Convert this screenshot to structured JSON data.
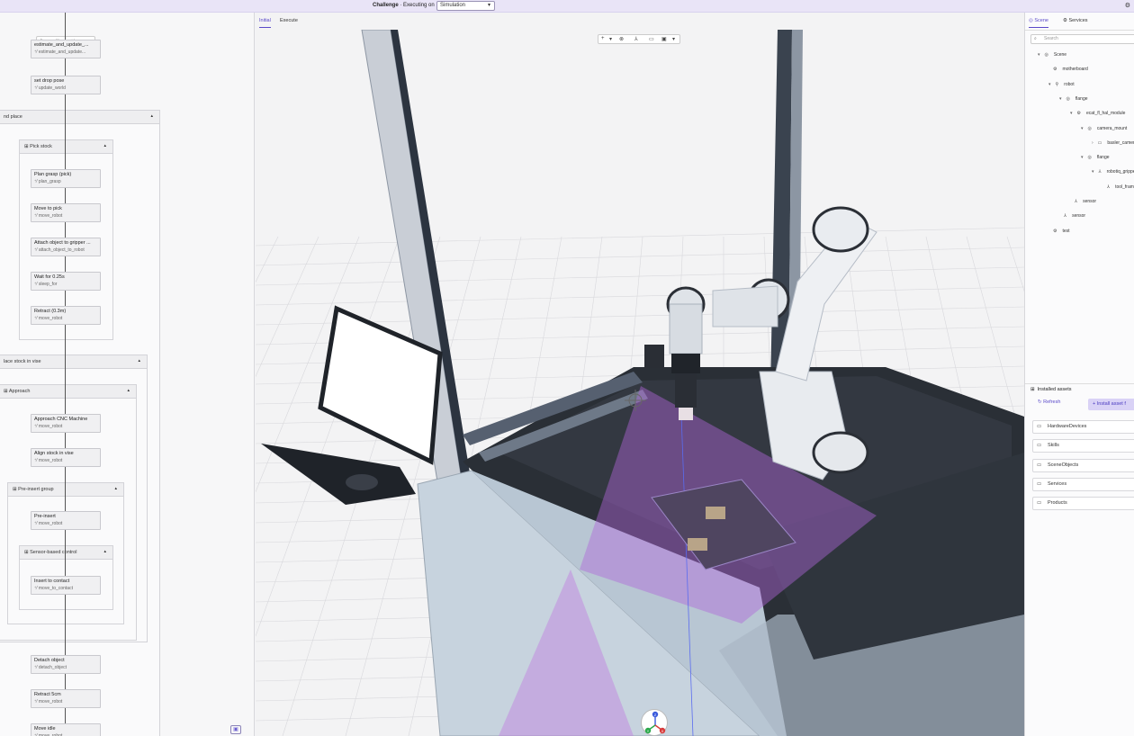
{
  "topbar": {
    "title_bold": "Challenge",
    "title_rest": " · Executing on",
    "executor": "Simulation",
    "settings_icon": "gear-icon"
  },
  "flow": {
    "controls": "▷ □ ⏭ ◎",
    "nodes": [
      {
        "title": "estimate_and_update_...",
        "skill": "estimate_and_update..."
      },
      {
        "title": "set drop pose",
        "skill": "update_world"
      },
      {
        "title": "Plan grasp (pick)",
        "skill": "plan_grasp"
      },
      {
        "title": "Move to pick",
        "skill": "move_robot"
      },
      {
        "title": "Attach object to gripper ...",
        "skill": "attach_object_to_robot"
      },
      {
        "title": "Wait for 0.25s",
        "skill": "sleep_for"
      },
      {
        "title": "Retract (0.3m)",
        "skill": "move_robot"
      },
      {
        "title": "Approach CNC Machine",
        "skill": "move_robot"
      },
      {
        "title": "Align stock in vise",
        "skill": "move_robot"
      },
      {
        "title": "Pre-insert",
        "skill": "move_robot"
      },
      {
        "title": "Insert to contact",
        "skill": "move_to_contact"
      },
      {
        "title": "Detach object",
        "skill": "detach_object"
      },
      {
        "title": "Retract 5cm",
        "skill": "move_robot"
      },
      {
        "title": "Move idle",
        "skill": "move_robot"
      }
    ],
    "groups": {
      "pick_and_place": "nd place",
      "pick_stock": "Pick stock",
      "place_stock": "lace stock in vise",
      "approach": "Approach",
      "pre_insert": "Pre-insert group",
      "sensor_control": "Sensor-based control"
    }
  },
  "viewport": {
    "tabs": [
      "Initial",
      "Execute"
    ],
    "toolbar": [
      "+",
      "▾",
      "⊗",
      "⅄",
      "▭",
      "▣",
      "▾"
    ],
    "gizmo_axes": [
      "Z",
      "Y",
      "X"
    ]
  },
  "right": {
    "tabs": [
      "Scene",
      "Services"
    ],
    "search_placeholder": "Search",
    "tree": [
      {
        "label": "Scene",
        "depth": 0,
        "caret": "▾",
        "icon": "◎"
      },
      {
        "label": "motherboard",
        "depth": 1,
        "caret": "",
        "icon": "⚙"
      },
      {
        "label": "robot",
        "depth": 1,
        "caret": "▾",
        "icon": "⚲"
      },
      {
        "label": "flange",
        "depth": 2,
        "caret": "▾",
        "icon": "◎"
      },
      {
        "label": "ecat_fl_hal_module",
        "depth": 3,
        "caret": "▾",
        "icon": "⚙"
      },
      {
        "label": "camera_mount",
        "depth": 4,
        "caret": "▾",
        "icon": "◎"
      },
      {
        "label": "basler_camera",
        "depth": 5,
        "caret": "›",
        "icon": "▭"
      },
      {
        "label": "flange",
        "depth": 4,
        "caret": "▾",
        "icon": "◎"
      },
      {
        "label": "robotiq_gripper",
        "depth": 5,
        "caret": "▾",
        "icon": "⅄"
      },
      {
        "label": "tool_frame",
        "depth": 6,
        "caret": "",
        "icon": "⅄"
      },
      {
        "label": "sensor",
        "depth": 3,
        "caret": "",
        "icon": "⅄"
      },
      {
        "label": "sensor",
        "depth": 2,
        "caret": "",
        "icon": "⅄"
      },
      {
        "label": "test",
        "depth": 1,
        "caret": "",
        "icon": "⚙"
      }
    ],
    "assets_title": "Installed assets",
    "refresh_label": "Refresh",
    "install_label": "Install asset f",
    "folders": [
      "HardwareDevices",
      "Skills",
      "SceneObjects",
      "Services",
      "Products"
    ]
  },
  "colors": {
    "accent": "#5a49c9",
    "camera_frustum": "#b066d9"
  }
}
